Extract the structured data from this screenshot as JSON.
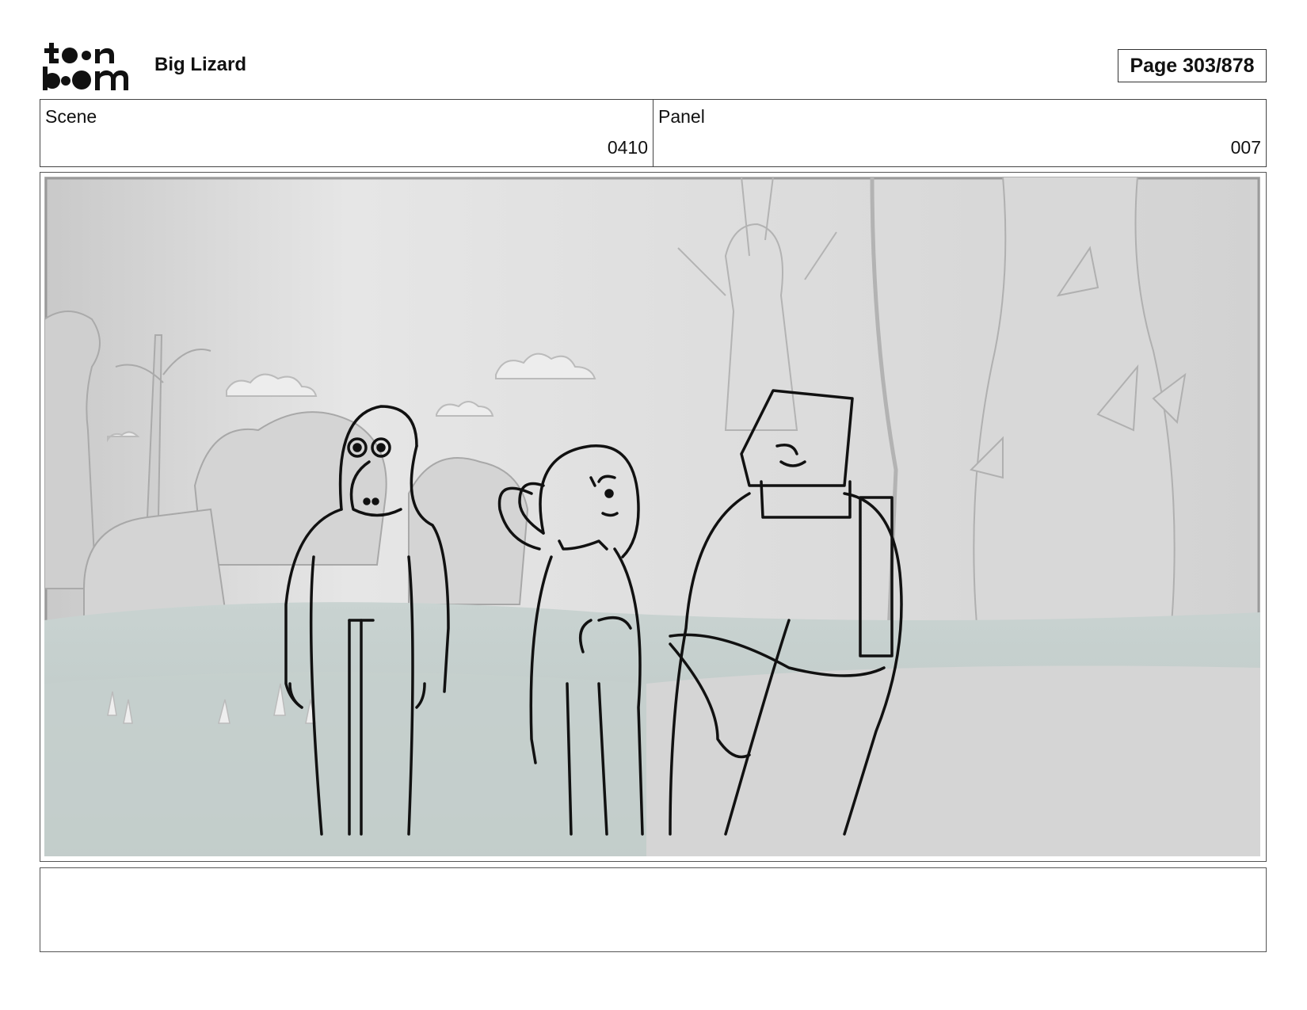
{
  "header": {
    "logo_text": "toon boom",
    "project_title": "Big Lizard",
    "page_label": "Page 303/878"
  },
  "info": {
    "scene_label": "Scene",
    "scene_value": "0410",
    "panel_label": "Panel",
    "panel_value": "007"
  },
  "notes": {
    "text": ""
  }
}
